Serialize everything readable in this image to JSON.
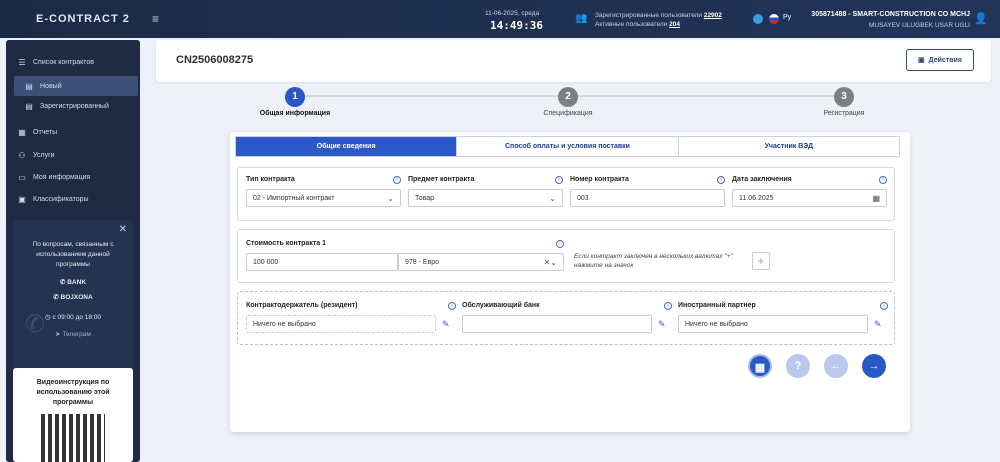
{
  "header": {
    "brand": "E-CONTRACT 2",
    "date": "11-06-2025, среда",
    "time": "14:49:36",
    "registered_label": "Зарегистрированные пользователи",
    "registered_count": "22902",
    "active_label": "Активные пользователи",
    "active_count": "204",
    "lang": "Ру",
    "company": "305871488 - SMART-CONSTRUCTION CO MCHJ",
    "person": "MUSAYEV ULUGBEK USAR UGLI"
  },
  "sidebar": {
    "items": [
      {
        "label": "Список контрактов"
      },
      {
        "label": "Новый"
      },
      {
        "label": "Зарегистрированный"
      },
      {
        "label": "Отчеты"
      },
      {
        "label": "Услуги"
      },
      {
        "label": "Моя информация"
      },
      {
        "label": "Классификаторы"
      }
    ],
    "help": {
      "question": "По вопросам, связанным с использованием данной программы",
      "bank": "BANK",
      "bojxona": "BOJXONA",
      "hours": "с 09:00 до 18:00",
      "telegram": "Телеграм"
    },
    "video": "Видеоинструкция по использованию этой программы"
  },
  "main": {
    "contract_id": "CN2506008275",
    "actions_label": "Действия",
    "steps": [
      {
        "num": "1",
        "label": "Общая информация"
      },
      {
        "num": "2",
        "label": "Спецификация"
      },
      {
        "num": "3",
        "label": "Регистрация"
      }
    ],
    "tabs": [
      {
        "label": "Общие сведения"
      },
      {
        "label": "Способ оплаты и условия поставки"
      },
      {
        "label": "Участник ВЭД"
      }
    ],
    "fields": {
      "contract_type": {
        "label": "Тип контракта",
        "value": "02 - Импортный контракт"
      },
      "subject": {
        "label": "Предмет контракта",
        "value": "Товар"
      },
      "number": {
        "label": "Номер контракта",
        "value": "003"
      },
      "date": {
        "label": "Дата заключения",
        "value": "11.06.2025"
      },
      "cost": {
        "label": "Стоимость контракта 1",
        "value": "100 000",
        "currency": "978 - Евро"
      },
      "cost_note": "Если контракт заключен в нескольких валютах \"+\" нажмите на значок",
      "holder": {
        "label": "Контрактодержатель (резидент)",
        "value": "Ничего не выбрано"
      },
      "bank": {
        "label": "Обслуживающий банк",
        "value": ""
      },
      "partner": {
        "label": "Иностранный партнер",
        "value": "Ничего не выбрано"
      }
    }
  },
  "colors": {
    "primary": "#2b58c7",
    "sidebar_bg": "#1e2b42",
    "header_bg": "#1b2a44"
  }
}
